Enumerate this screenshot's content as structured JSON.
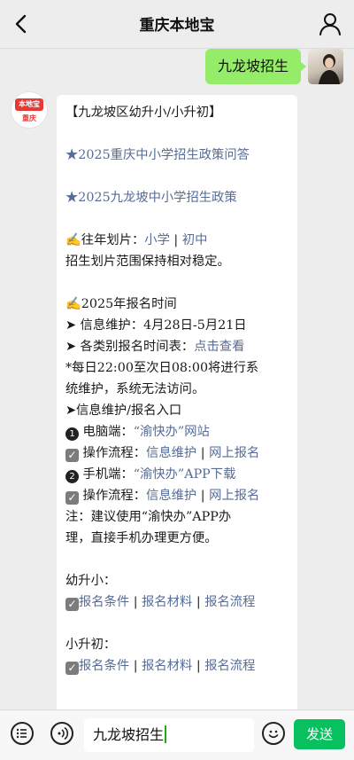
{
  "header": {
    "title": "重庆本地宝"
  },
  "user_message": {
    "text": "九龙坡招生"
  },
  "bot_avatar": {
    "logo_text": "本地宝",
    "city": "重庆"
  },
  "bot_message": {
    "heading": "【九龙坡区幼升小/小升初】",
    "link1": "★2025重庆中小学招生政策问答",
    "link2": "★2025九龙坡中小学招生政策",
    "prev_prefix": "✍往年划片：",
    "prev_link_a": "小学",
    "prev_sep": " | ",
    "prev_link_b": "初中",
    "prev_note": "招生划片范围保持相对稳定。",
    "reg_title": "✍2025年报名时间",
    "info_maint": "➤ 信息维护：4月28日-5月21日",
    "schedule_prefix": "➤ 各类别报名时间表：",
    "schedule_link": "点击查看",
    "maint_note_1": "*每日22:00至次日08:00将进行系",
    "maint_note_2": "统维护，系统无法访问。",
    "entry_title": "➤信息维护/报名入口",
    "pc_prefix": "电脑端：",
    "pc_link": "“渝快办”网站",
    "pc_flow_prefix": "操作流程：",
    "pc_flow_a": "信息维护",
    "pc_flow_sep": " | ",
    "pc_flow_b": "网上报名",
    "mobile_prefix": "手机端：",
    "mobile_link": "“渝快办”APP下载",
    "mobile_flow_prefix": "操作流程：",
    "mobile_flow_a": "信息维护",
    "mobile_flow_sep": " | ",
    "mobile_flow_b": "网上报名",
    "note_1": "注：建议使用“渝快办”APP办",
    "note_2": "理，直接手机办理更方便。",
    "kid_title": "幼升小：",
    "kid_a": "报名条件",
    "kid_b": "报名材料",
    "kid_c": "报名流程",
    "mid_title": "小升初：",
    "mid_a": "报名条件",
    "mid_b": "报名材料",
    "mid_c": "报名流程",
    "sep": " | "
  },
  "input_bar": {
    "value": "九龙坡招生",
    "send_label": "发送"
  },
  "colors": {
    "send_button": "#07c160",
    "user_bubble": "#95ec69",
    "link": "#576b95"
  }
}
